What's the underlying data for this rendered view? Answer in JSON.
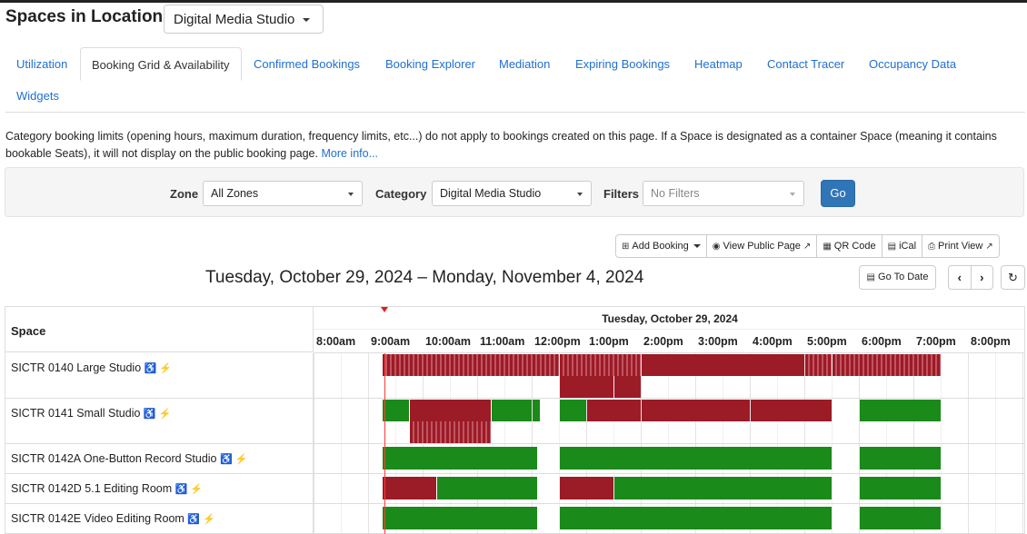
{
  "header": {
    "title": "Spaces in Location",
    "location_select": "Digital Media Studio"
  },
  "tabs": [
    {
      "label": "Utilization",
      "active": false
    },
    {
      "label": "Booking Grid & Availability",
      "active": true
    },
    {
      "label": "Confirmed Bookings",
      "active": false
    },
    {
      "label": "Booking Explorer",
      "active": false
    },
    {
      "label": "Mediation",
      "active": false
    },
    {
      "label": "Expiring Bookings",
      "active": false
    },
    {
      "label": "Heatmap",
      "active": false
    },
    {
      "label": "Contact Tracer",
      "active": false
    },
    {
      "label": "Occupancy Data",
      "active": false
    },
    {
      "label": "Widgets",
      "active": false
    }
  ],
  "info": {
    "text": "Category booking limits (opening hours, maximum duration, frequency limits, etc...) do not apply to bookings created on this page. If a Space is designated as a container Space (meaning it contains bookable Seats), it will not display on the public booking page.",
    "link": "More info..."
  },
  "filters": {
    "zone_label": "Zone",
    "zone_value": "All Zones",
    "category_label": "Category",
    "category_value": "Digital Media Studio",
    "filters_label": "Filters",
    "filters_placeholder": "No Filters",
    "go_label": "Go"
  },
  "toolbar": {
    "add_booking": "Add Booking",
    "view_public": "View Public Page",
    "qr_code": "QR Code",
    "ical": "iCal",
    "print_view": "Print View"
  },
  "calendar": {
    "range_title": "Tuesday, October 29, 2024 – Monday, November 4, 2024",
    "goto_label": "Go To Date",
    "prev_label": "‹",
    "next_label": "›",
    "refresh_label": "↻",
    "space_header": "Space",
    "day_header": "Tuesday, October 29, 2024",
    "hours": [
      "8:00am",
      "9:00am",
      "10:00am",
      "11:00am",
      "12:00pm",
      "1:00pm",
      "2:00pm",
      "3:00pm",
      "4:00pm",
      "5:00pm",
      "6:00pm",
      "7:00pm",
      "8:00pm"
    ],
    "current_time": 9.3
  },
  "rooms": [
    {
      "name": "SICTR 0140 Large Studio",
      "bookings": [
        {
          "start": 9.25,
          "end": 12.5,
          "type": "stripe",
          "lane": 0
        },
        {
          "start": 12.5,
          "end": 14.0,
          "type": "stripe",
          "lane": 0
        },
        {
          "start": 14.0,
          "end": 17.0,
          "type": "red",
          "lane": 0
        },
        {
          "start": 17.0,
          "end": 17.5,
          "type": "stripe",
          "lane": 0
        },
        {
          "start": 17.5,
          "end": 19.5,
          "type": "stripe",
          "lane": 0
        },
        {
          "start": 12.5,
          "end": 13.5,
          "type": "red",
          "lane": 1
        },
        {
          "start": 13.5,
          "end": 14.0,
          "type": "red",
          "lane": 1
        }
      ]
    },
    {
      "name": "SICTR 0141 Small Studio",
      "bookings": [
        {
          "start": 9.25,
          "end": 9.75,
          "type": "green",
          "lane": 0
        },
        {
          "start": 9.75,
          "end": 11.25,
          "type": "red",
          "lane": 0
        },
        {
          "start": 11.25,
          "end": 12.0,
          "type": "green",
          "lane": 0
        },
        {
          "start": 12.0,
          "end": 12.15,
          "type": "green",
          "lane": 0
        },
        {
          "start": 12.5,
          "end": 13.0,
          "type": "green",
          "lane": 0
        },
        {
          "start": 13.0,
          "end": 14.0,
          "type": "red",
          "lane": 0
        },
        {
          "start": 14.0,
          "end": 16.0,
          "type": "red",
          "lane": 0
        },
        {
          "start": 16.0,
          "end": 17.5,
          "type": "red",
          "lane": 0
        },
        {
          "start": 18.0,
          "end": 19.5,
          "type": "green",
          "lane": 0
        },
        {
          "start": 9.75,
          "end": 11.25,
          "type": "stripe",
          "lane": 1
        }
      ]
    },
    {
      "name": "SICTR 0142A One-Button Record Studio",
      "bookings": [
        {
          "start": 9.25,
          "end": 12.1,
          "type": "green",
          "lane": 0
        },
        {
          "start": 12.5,
          "end": 17.5,
          "type": "green",
          "lane": 0
        },
        {
          "start": 18.0,
          "end": 19.5,
          "type": "green",
          "lane": 0
        }
      ]
    },
    {
      "name": "SICTR 0142D 5.1 Editing Room",
      "bookings": [
        {
          "start": 9.25,
          "end": 10.25,
          "type": "red",
          "lane": 0
        },
        {
          "start": 10.25,
          "end": 12.1,
          "type": "green",
          "lane": 0
        },
        {
          "start": 12.5,
          "end": 13.5,
          "type": "red",
          "lane": 0
        },
        {
          "start": 13.5,
          "end": 17.5,
          "type": "green",
          "lane": 0
        },
        {
          "start": 18.0,
          "end": 19.5,
          "type": "green",
          "lane": 0
        }
      ]
    },
    {
      "name": "SICTR 0142E Video Editing Room",
      "bookings": [
        {
          "start": 9.25,
          "end": 12.1,
          "type": "green",
          "lane": 0
        },
        {
          "start": 12.5,
          "end": 17.5,
          "type": "green",
          "lane": 0
        },
        {
          "start": 18.0,
          "end": 19.5,
          "type": "green",
          "lane": 0
        }
      ]
    }
  ],
  "colors": {
    "link": "#1f6fd1",
    "available": "#1a8a1a",
    "booked": "#9b1b26",
    "now_line": "#ff3b3b",
    "primary_button": "#2f75b8"
  },
  "icons": {
    "accessible": "wheelchair-icon",
    "power": "plug-icon"
  }
}
